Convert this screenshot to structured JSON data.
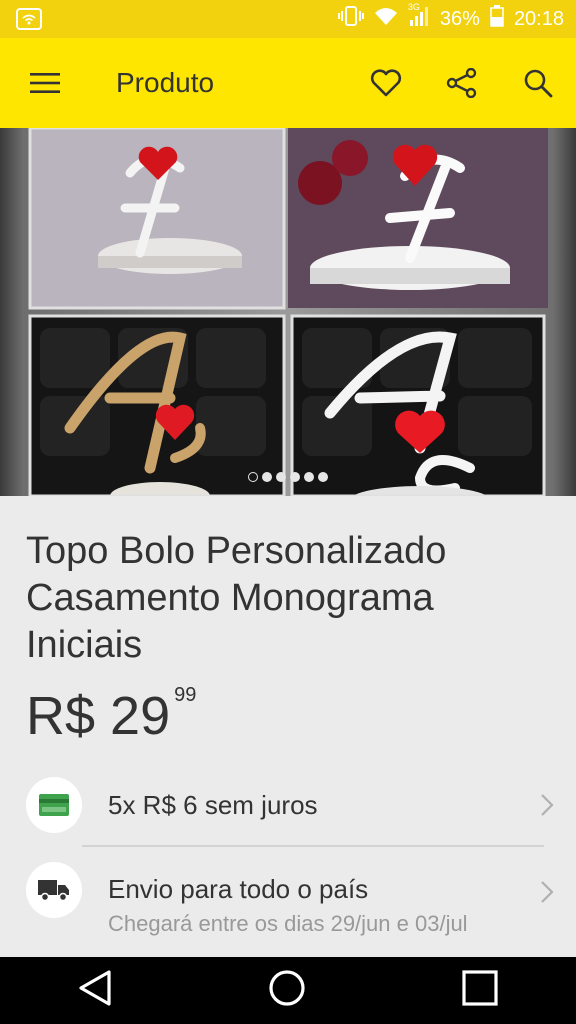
{
  "status_bar": {
    "battery": "36%",
    "network": "3G",
    "time": "20:18"
  },
  "app_bar": {
    "title": "Produto",
    "icons": [
      "menu-icon",
      "heart-icon",
      "share-icon",
      "search-icon"
    ]
  },
  "gallery": {
    "page_count": 6,
    "current_page": 1
  },
  "product": {
    "title": "Topo Bolo Personalizado Casamento Monograma Iniciais",
    "price_main": "R$ 29",
    "price_cents": "99"
  },
  "installments": {
    "text": "5x R$ 6 sem juros",
    "icon": "credit-card-icon"
  },
  "shipping": {
    "title": "Envio para todo o país",
    "subtitle": "Chegará entre os dias 29/jun e 03/jul",
    "icon": "truck-icon"
  },
  "nav_bar": {
    "icons": [
      "back-icon",
      "home-icon",
      "recents-icon"
    ]
  },
  "colors": {
    "brand_yellow": "#ffe600",
    "status_yellow": "#f2d20e",
    "card_green": "#3fa34d"
  }
}
